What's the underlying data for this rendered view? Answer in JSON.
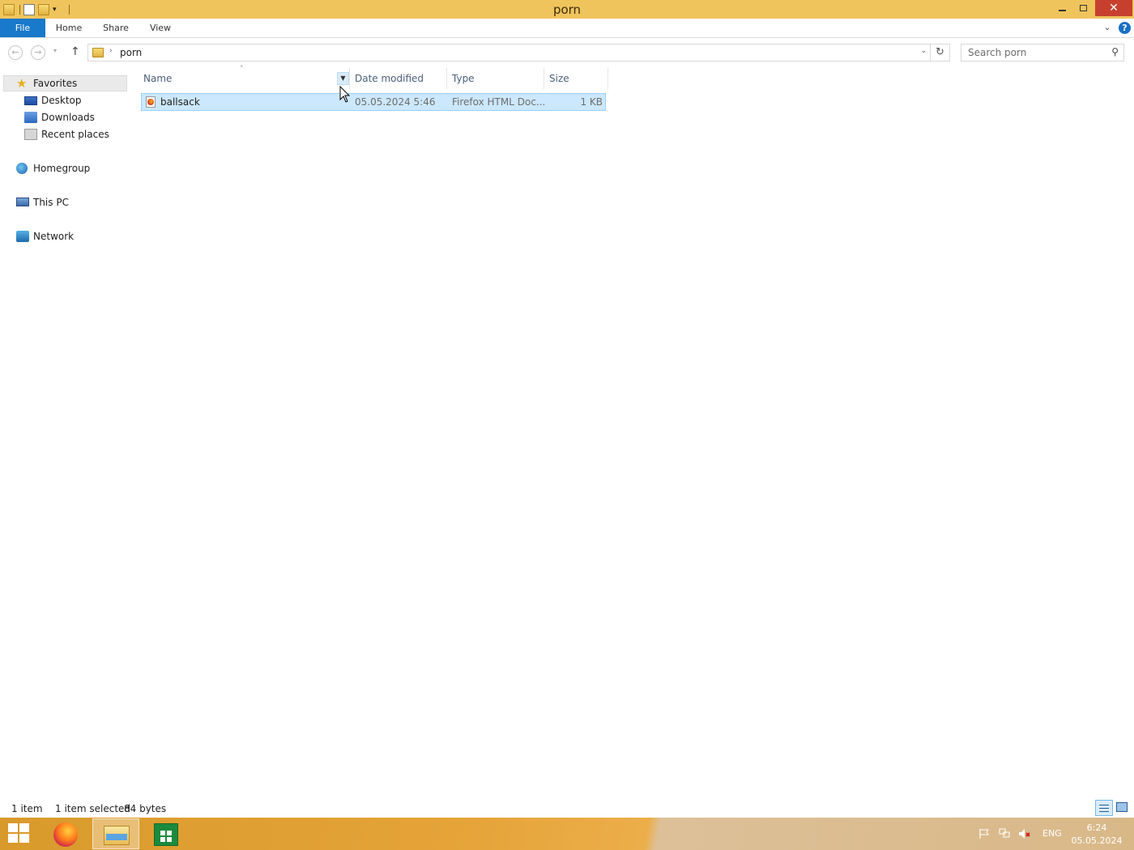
{
  "window": {
    "title": "porn",
    "close_glyph": "✕"
  },
  "ribbon": {
    "tabs": [
      "File",
      "Home",
      "Share",
      "View"
    ]
  },
  "nav": {
    "back_glyph": "←",
    "forward_glyph": "→",
    "recent_glyph": "▾",
    "up_glyph": "↑"
  },
  "address": {
    "breadcrumb": "porn",
    "crumb_separator": "›",
    "dropdown_glyph": "⌄",
    "refresh_glyph": "↻"
  },
  "search": {
    "placeholder": "Search porn",
    "icon": "search-icon"
  },
  "navpane": {
    "favorites": "Favorites",
    "favorites_items": [
      "Desktop",
      "Downloads",
      "Recent places"
    ],
    "homegroup": "Homegroup",
    "this_pc": "This PC",
    "network": "Network"
  },
  "filelist": {
    "columns": [
      "Name",
      "Date modified",
      "Type",
      "Size"
    ],
    "sort_indicator": "ˆ",
    "rows": [
      {
        "name": "ballsack",
        "date_modified": "05.05.2024 5:46",
        "type": "Firefox HTML Doc...",
        "size": "1 KB",
        "selected": true
      }
    ]
  },
  "status": {
    "item_count": "1 item",
    "selection": "1 item selected",
    "selection_size": "84 bytes"
  },
  "taskbar": {
    "apps": [
      "start-icon",
      "firefox-icon",
      "file-explorer-icon",
      "store-icon"
    ],
    "language": "ENG",
    "time": "6:24",
    "date": "05.05.2024"
  },
  "colors": {
    "titlebar": "#f0c45c",
    "file_tab": "#1979ca",
    "selection_fill": "#cce8ff",
    "selection_border": "#99d1ff",
    "close_button": "#c7402e",
    "column_header_text": "#4c607a"
  }
}
